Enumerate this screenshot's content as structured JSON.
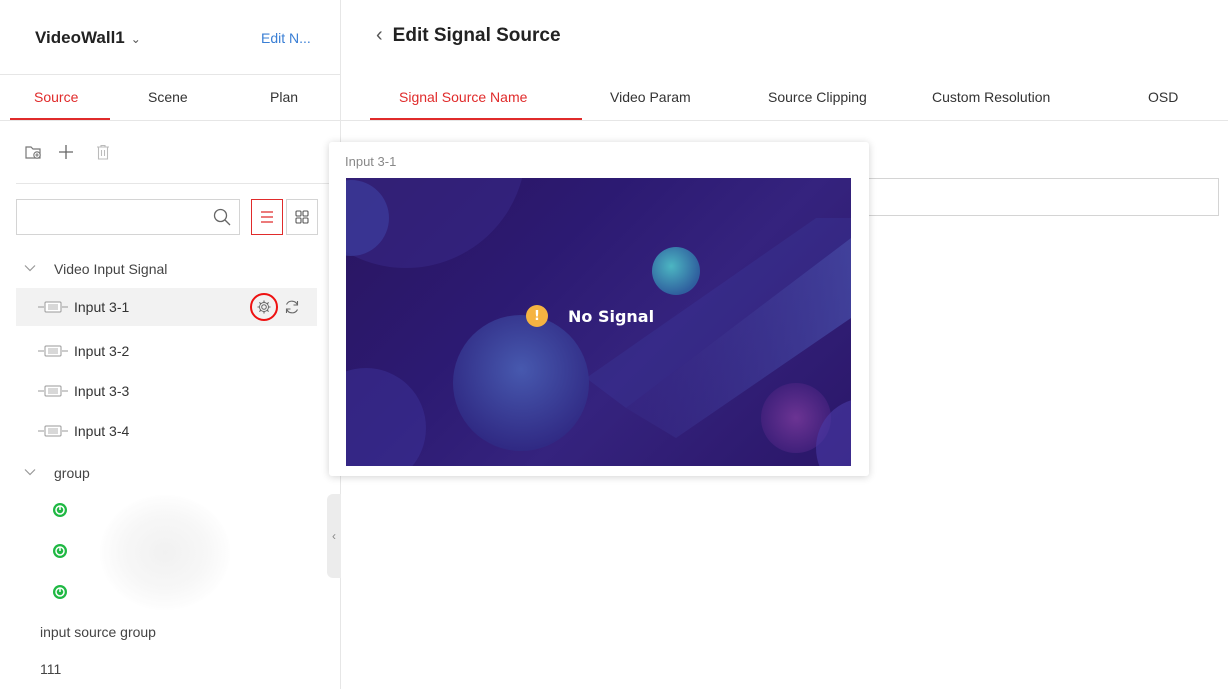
{
  "left_panel": {
    "wall_name": "VideoWall1",
    "wall_caret": "⌄",
    "edit_link": "Edit N...",
    "tabs": [
      {
        "label": "Source",
        "active": true
      },
      {
        "label": "Scene",
        "active": false
      },
      {
        "label": "Plan",
        "active": false
      }
    ],
    "toolbar_icons": [
      "add-folder-icon",
      "add-icon",
      "delete-icon"
    ],
    "search": {
      "placeholder": "",
      "value": ""
    },
    "view_modes": [
      "list-view-icon",
      "grid-view-icon"
    ],
    "tree": {
      "video_input_group": "Video Input Signal",
      "inputs": [
        "Input 3-1",
        "Input 3-2",
        "Input 3-3",
        "Input 3-4"
      ],
      "selected_input": "Input 3-1",
      "group_label": "group",
      "group_member_count": 3,
      "input_source_group": "input source group",
      "extra_item": "111"
    },
    "collapse_glyph": "‹"
  },
  "main": {
    "back_glyph": "‹",
    "title": "Edit Signal Source",
    "tabs": [
      {
        "label": "Signal Source Name",
        "active": true
      },
      {
        "label": "Video Param",
        "active": false
      },
      {
        "label": "Source Clipping",
        "active": false
      },
      {
        "label": "Custom Resolution",
        "active": false
      },
      {
        "label": "OSD",
        "active": false
      }
    ],
    "name_field_value": ""
  },
  "preview_popover": {
    "title": "Input 3-1",
    "status_text": "No Signal",
    "warning_glyph": "!"
  },
  "colors": {
    "accent": "#e02b2b",
    "link": "#3a7fd5",
    "online": "#1fb843",
    "preview_bg": "#2c1a72",
    "warning": "#f5b342"
  }
}
